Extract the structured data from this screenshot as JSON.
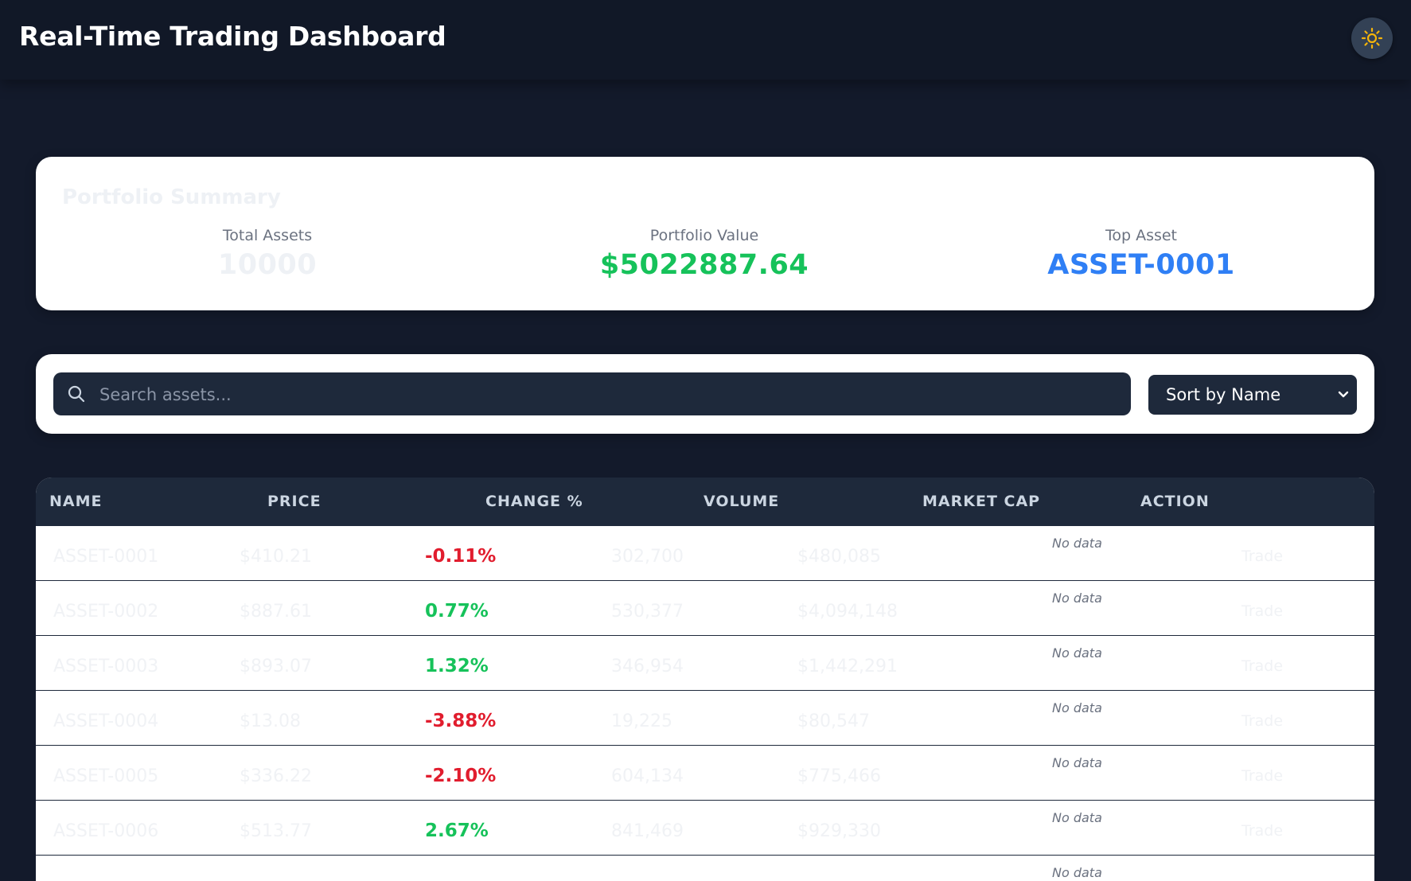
{
  "header": {
    "title": "Real-Time Trading Dashboard",
    "theme_icon": "sun-icon"
  },
  "summary": {
    "title": "Portfolio Summary",
    "total_assets_label": "Total Assets",
    "total_assets_value": "10000",
    "portfolio_value_label": "Portfolio Value",
    "portfolio_value": "$5022887.64",
    "top_asset_label": "Top Asset",
    "top_asset_value": "ASSET-0001"
  },
  "controls": {
    "search_placeholder": "Search assets...",
    "sort_selected": "Sort by Name"
  },
  "table": {
    "columns": [
      "NAME",
      "PRICE",
      "CHANGE %",
      "VOLUME",
      "MARKET CAP",
      "ACTION"
    ],
    "rows": [
      {
        "name": "ASSET-0001",
        "price": "$410.21",
        "change": "-0.11%",
        "direction": "down",
        "volume": "302,700",
        "market_cap": "$480,085",
        "note": "No data",
        "action": "Trade"
      },
      {
        "name": "ASSET-0002",
        "price": "$887.61",
        "change": "0.77%",
        "direction": "up",
        "volume": "530,377",
        "market_cap": "$4,094,148",
        "note": "No data",
        "action": "Trade"
      },
      {
        "name": "ASSET-0003",
        "price": "$893.07",
        "change": "1.32%",
        "direction": "up",
        "volume": "346,954",
        "market_cap": "$1,442,291",
        "note": "No data",
        "action": "Trade"
      },
      {
        "name": "ASSET-0004",
        "price": "$13.08",
        "change": "-3.88%",
        "direction": "down",
        "volume": "19,225",
        "market_cap": "$80,547",
        "note": "No data",
        "action": "Trade"
      },
      {
        "name": "ASSET-0005",
        "price": "$336.22",
        "change": "-2.10%",
        "direction": "down",
        "volume": "604,134",
        "market_cap": "$775,466",
        "note": "No data",
        "action": "Trade"
      },
      {
        "name": "ASSET-0006",
        "price": "$513.77",
        "change": "2.67%",
        "direction": "up",
        "volume": "841,469",
        "market_cap": "$929,330",
        "note": "No data",
        "action": "Trade"
      },
      {
        "name": "",
        "price": "",
        "change": "",
        "direction": "",
        "volume": "",
        "market_cap": "",
        "note": "No data",
        "action": ""
      }
    ]
  },
  "colors": {
    "background": "#131a2b",
    "header": "#111827",
    "positive": "#16c25a",
    "negative": "#e11d2e",
    "accent": "#2f7ff5",
    "sun": "#f5b50a"
  }
}
